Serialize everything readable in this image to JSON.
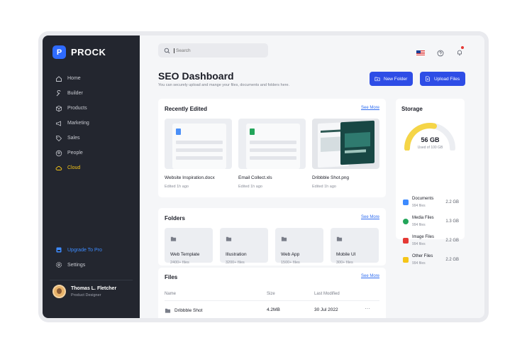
{
  "brand": {
    "name": "PROCK",
    "mark": "P"
  },
  "sidebar": {
    "items": [
      {
        "label": "Home",
        "icon": "home-icon"
      },
      {
        "label": "Builder",
        "icon": "wrench-icon"
      },
      {
        "label": "Products",
        "icon": "box-icon"
      },
      {
        "label": "Marketing",
        "icon": "megaphone-icon"
      },
      {
        "label": "Sales",
        "icon": "tag-icon"
      },
      {
        "label": "People",
        "icon": "user-circle-icon"
      },
      {
        "label": "Cloud",
        "icon": "cloud-icon",
        "active": true
      }
    ],
    "upgrade_label": "Upgrade To Pro",
    "settings_label": "Settings",
    "profile": {
      "name": "Thomas L. Fletcher",
      "role": "Product Designer"
    }
  },
  "search": {
    "placeholder": "Search"
  },
  "header": {
    "title": "SEO Dashboard",
    "subtitle": "You can securely upload and mange your files, documents and folders here.",
    "new_folder_label": "New Folder",
    "upload_files_label": "Upload Files"
  },
  "recent": {
    "title": "Recently Edited",
    "see_more": "See More",
    "items": [
      {
        "name": "Website Inspiration.docx",
        "time": "Edited 1h ago",
        "kind": "doc",
        "color": "#4a8ff7"
      },
      {
        "name": "Email Collect.xls",
        "time": "Edited 1h ago",
        "kind": "sheet",
        "color": "#23a55a"
      },
      {
        "name": "Dribbble Shot.png",
        "time": "Edited 1h ago",
        "kind": "image"
      }
    ]
  },
  "folders": {
    "title": "Folders",
    "see_more": "See More",
    "items": [
      {
        "name": "Web Template",
        "count": "2400+ files"
      },
      {
        "name": "Illustration",
        "count": "3200+ files"
      },
      {
        "name": "Web App",
        "count": "1500+ files"
      },
      {
        "name": "Mobile UI",
        "count": "300+ files"
      }
    ]
  },
  "files": {
    "title": "Files",
    "see_more": "See More",
    "columns": [
      "Name",
      "Size",
      "Last Modified"
    ],
    "rows": [
      {
        "name": "Dribbble Shot",
        "size": "4.2MB",
        "modified": "30 Jul 2022",
        "more": "···"
      }
    ]
  },
  "storage": {
    "title": "Storage",
    "used": "56 GB",
    "used_of": "Used of 100 GB",
    "used_fraction": 0.56,
    "accent": "#f5d547",
    "items": [
      {
        "name": "Documents",
        "count": "994 files",
        "size": "2.2 GB",
        "color": "#3d8bff"
      },
      {
        "name": "Media Files",
        "count": "994 files",
        "size": "1.3 GB",
        "color": "#23a55a"
      },
      {
        "name": "Image Files",
        "count": "994 files",
        "size": "2.2 GB",
        "color": "#e53935"
      },
      {
        "name": "Other Files",
        "count": "994 files",
        "size": "2.2 GB",
        "color": "#f5c518"
      }
    ]
  }
}
